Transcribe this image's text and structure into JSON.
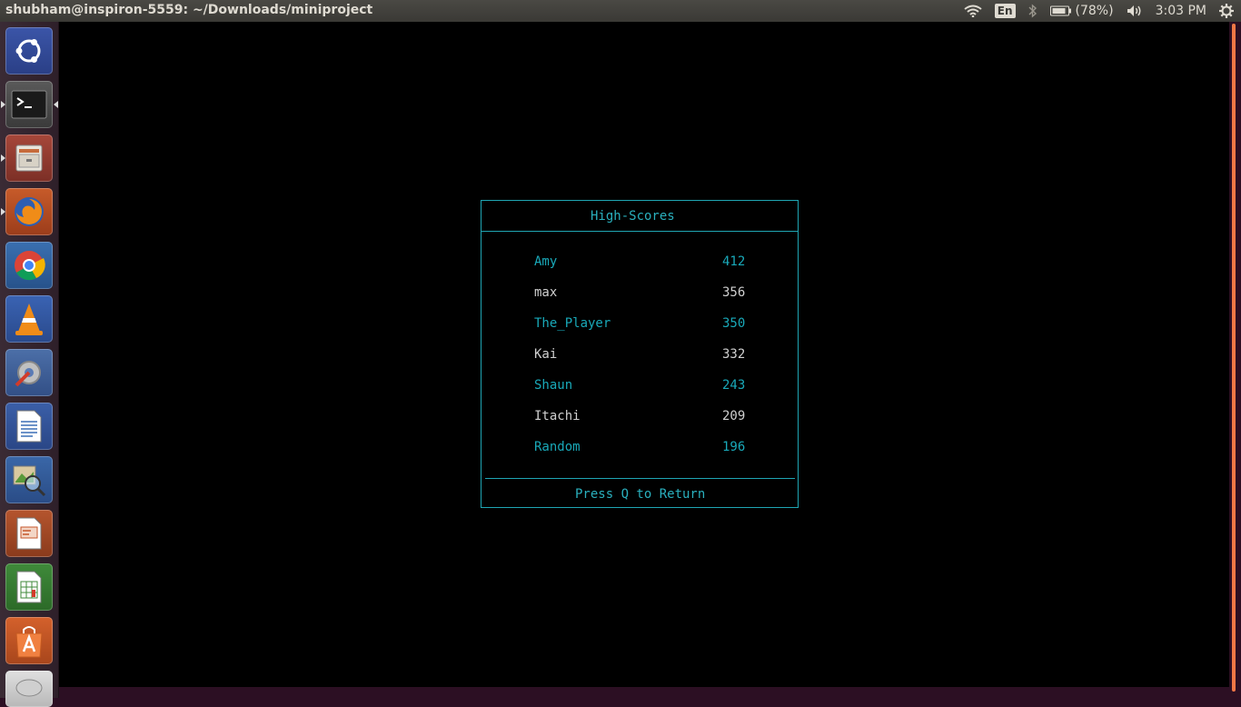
{
  "window": {
    "title": "shubham@inspiron-5559: ~/Downloads/miniproject"
  },
  "indicators": {
    "keyboard": "En",
    "battery": "(78%)",
    "clock": "3:03 PM"
  },
  "launcher": {
    "items": [
      {
        "name": "ubuntu-dash"
      },
      {
        "name": "terminal"
      },
      {
        "name": "file-manager"
      },
      {
        "name": "firefox"
      },
      {
        "name": "chrome"
      },
      {
        "name": "vlc"
      },
      {
        "name": "system-settings"
      },
      {
        "name": "libreoffice-writer"
      },
      {
        "name": "image-viewer"
      },
      {
        "name": "libreoffice-impress"
      },
      {
        "name": "libreoffice-calc"
      },
      {
        "name": "software-center"
      },
      {
        "name": "drive"
      }
    ]
  },
  "highscores": {
    "title": "High-Scores",
    "rows": [
      {
        "name": "Amy",
        "score": "412"
      },
      {
        "name": "max",
        "score": "356"
      },
      {
        "name": "The_Player",
        "score": "350"
      },
      {
        "name": "Kai",
        "score": "332"
      },
      {
        "name": "Shaun",
        "score": "243"
      },
      {
        "name": "Itachi",
        "score": "209"
      },
      {
        "name": "Random",
        "score": "196"
      }
    ],
    "footer": "Press Q to Return"
  },
  "colors": {
    "accent": "#1fa5b3",
    "text_alt": "#d0d0d0",
    "scroll_thumb": "#f07746"
  }
}
